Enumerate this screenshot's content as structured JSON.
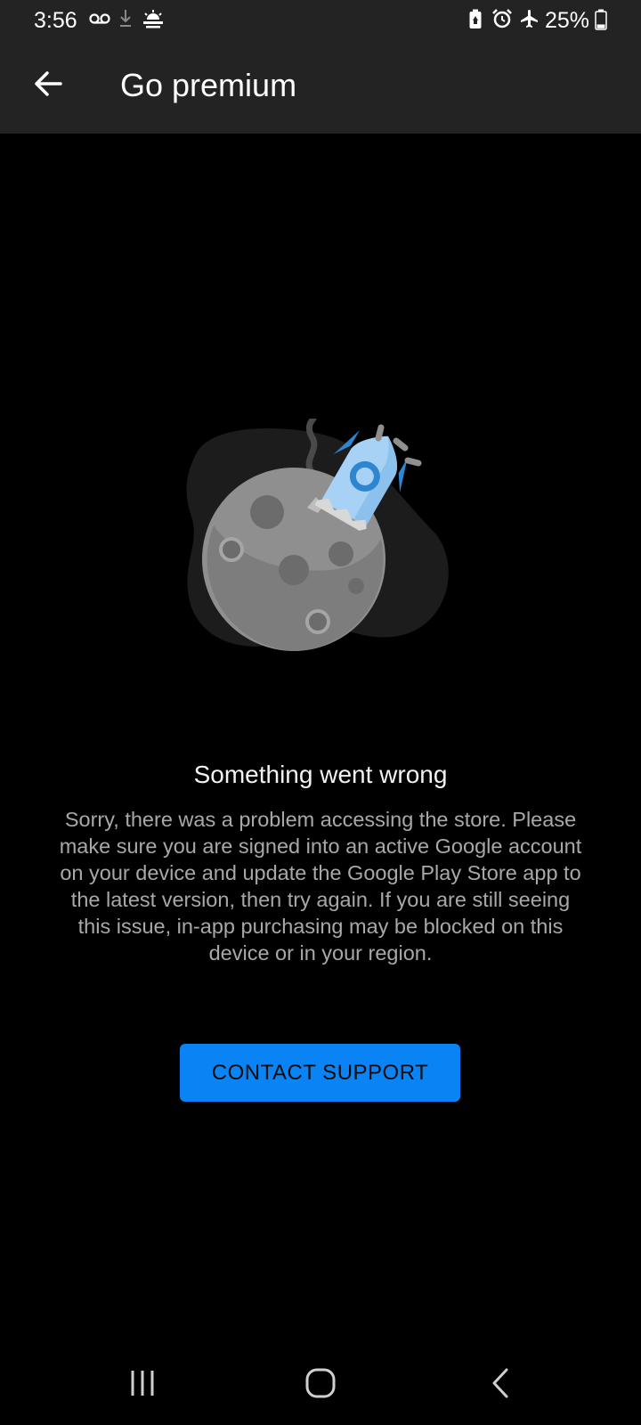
{
  "status_bar": {
    "time": "3:56",
    "battery_percent": "25%",
    "battery_level": 0.25,
    "icons": [
      "voicemail-icon",
      "download-icon",
      "weather-icon",
      "battery-saver-icon",
      "alarm-icon",
      "airplane-mode-icon",
      "battery-icon"
    ]
  },
  "app_bar": {
    "title": "Go premium",
    "back_icon": "back-arrow-icon"
  },
  "error": {
    "title": "Something went wrong",
    "message": "Sorry, there was a problem accessing the store. Please make sure you are signed into an active Google account on your device and update the Google Play Store app to the latest version, then try again. If you are still seeing this issue, in-app purchasing may be blocked on this device or in your region."
  },
  "actions": {
    "contact_support_label": "CONTACT SUPPORT"
  },
  "nav_bar": {
    "icons": [
      "recent-apps-icon",
      "home-icon",
      "nav-back-icon"
    ]
  },
  "colors": {
    "background": "#000000",
    "app_bar": "#232323",
    "accent": "#0a84f5",
    "title_text": "#f2f2f2",
    "body_text": "#a8a8a8"
  }
}
